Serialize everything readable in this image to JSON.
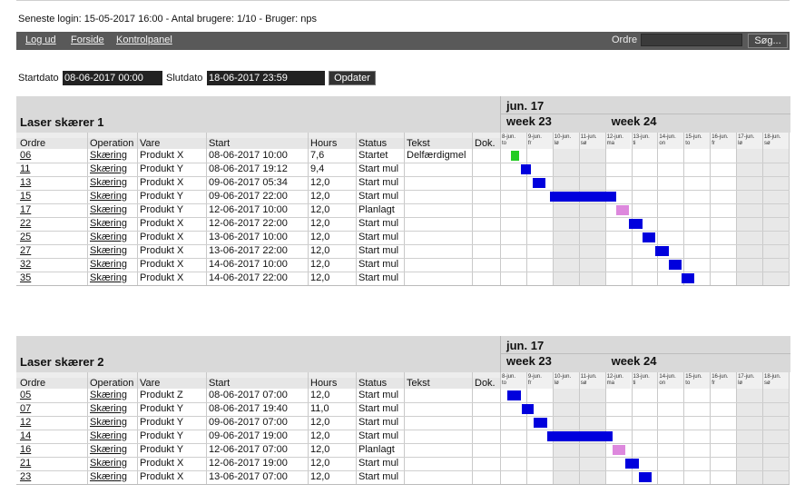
{
  "header": {
    "login_info": "Seneste login: 15-05-2017 16:00 - Antal brugere: 1/10 - Bruger: nps"
  },
  "nav": {
    "logout": "Log ud",
    "home": "Forside",
    "control_panel": "Kontrolpanel",
    "order_label": "Ordre",
    "order_value": "",
    "search_button": "Søg..."
  },
  "filter": {
    "start_label": "Startdato",
    "start_value": "08-06-2017 00:00",
    "end_label": "Slutdato",
    "end_value": "18-06-2017 23:59",
    "update_button": "Opdater"
  },
  "columns": [
    "Ordre",
    "Operation",
    "Vare",
    "Start",
    "Hours",
    "Status",
    "Tekst",
    "Dok."
  ],
  "gantt": {
    "month": "jun. 17",
    "weeks": [
      "week 23",
      "week 24"
    ],
    "days": [
      {
        "date": "8-jun.",
        "dow": "to"
      },
      {
        "date": "9-jun.",
        "dow": "fr"
      },
      {
        "date": "10-jun.",
        "dow": "lø"
      },
      {
        "date": "11-jun.",
        "dow": "sø"
      },
      {
        "date": "12-jun.",
        "dow": "ma"
      },
      {
        "date": "13-jun.",
        "dow": "ti"
      },
      {
        "date": "14-jun.",
        "dow": "on"
      },
      {
        "date": "15-jun.",
        "dow": "to"
      },
      {
        "date": "16-jun.",
        "dow": "fr"
      },
      {
        "date": "17-jun.",
        "dow": "lø"
      },
      {
        "date": "18-jun.",
        "dow": "sø"
      }
    ],
    "weekend_days": [
      2,
      3,
      9,
      10
    ]
  },
  "colors": {
    "started": "#22cc22",
    "start_mul": "#0000dd",
    "planned": "#dd88dd"
  },
  "panels": [
    {
      "title": "Laser skærer 1",
      "rows": [
        {
          "order": "06",
          "operation": "Skæring",
          "item": "Produkt X",
          "start": "08-06-2017 10:00",
          "hours": "7,6",
          "status": "Startet",
          "text": "Delfærdigmel",
          "bar_start_day": 0.42,
          "bar_length_days": 0.32,
          "kind": "started"
        },
        {
          "order": "11",
          "operation": "Skæring",
          "item": "Produkt Y",
          "start": "08-06-2017 19:12",
          "hours": "9,4",
          "status": "Start mul",
          "text": "",
          "bar_start_day": 0.8,
          "bar_length_days": 0.39,
          "kind": "start_mul"
        },
        {
          "order": "13",
          "operation": "Skæring",
          "item": "Produkt X",
          "start": "09-06-2017 05:34",
          "hours": "12,0",
          "status": "Start mul",
          "text": "",
          "bar_start_day": 1.23,
          "bar_length_days": 0.5,
          "kind": "start_mul"
        },
        {
          "order": "15",
          "operation": "Skæring",
          "item": "Produkt Y",
          "start": "09-06-2017 22:00",
          "hours": "12,0",
          "status": "Start mul",
          "text": "",
          "bar_start_day": 1.92,
          "bar_length_days": 2.5,
          "kind": "start_mul"
        },
        {
          "order": "17",
          "operation": "Skæring",
          "item": "Produkt Y",
          "start": "12-06-2017 10:00",
          "hours": "12,0",
          "status": "Planlagt",
          "text": "",
          "bar_start_day": 4.42,
          "bar_length_days": 0.5,
          "kind": "planned"
        },
        {
          "order": "22",
          "operation": "Skæring",
          "item": "Produkt X",
          "start": "12-06-2017 22:00",
          "hours": "12,0",
          "status": "Start mul",
          "text": "",
          "bar_start_day": 4.92,
          "bar_length_days": 0.5,
          "kind": "start_mul"
        },
        {
          "order": "25",
          "operation": "Skæring",
          "item": "Produkt X",
          "start": "13-06-2017 10:00",
          "hours": "12,0",
          "status": "Start mul",
          "text": "",
          "bar_start_day": 5.42,
          "bar_length_days": 0.5,
          "kind": "start_mul"
        },
        {
          "order": "27",
          "operation": "Skæring",
          "item": "Produkt X",
          "start": "13-06-2017 22:00",
          "hours": "12,0",
          "status": "Start mul",
          "text": "",
          "bar_start_day": 5.92,
          "bar_length_days": 0.5,
          "kind": "start_mul"
        },
        {
          "order": "32",
          "operation": "Skæring",
          "item": "Produkt X",
          "start": "14-06-2017 10:00",
          "hours": "12,0",
          "status": "Start mul",
          "text": "",
          "bar_start_day": 6.42,
          "bar_length_days": 0.5,
          "kind": "start_mul"
        },
        {
          "order": "35",
          "operation": "Skæring",
          "item": "Produkt X",
          "start": "14-06-2017 22:00",
          "hours": "12,0",
          "status": "Start mul",
          "text": "",
          "bar_start_day": 6.92,
          "bar_length_days": 0.5,
          "kind": "start_mul"
        }
      ]
    },
    {
      "title": "Laser skærer 2",
      "rows": [
        {
          "order": "05",
          "operation": "Skæring",
          "item": "Produkt Z",
          "start": "08-06-2017 07:00",
          "hours": "12,0",
          "status": "Start mul",
          "text": "",
          "bar_start_day": 0.29,
          "bar_length_days": 0.5,
          "kind": "start_mul"
        },
        {
          "order": "07",
          "operation": "Skæring",
          "item": "Produkt Y",
          "start": "08-06-2017 19:40",
          "hours": "11,0",
          "status": "Start mul",
          "text": "",
          "bar_start_day": 0.82,
          "bar_length_days": 0.46,
          "kind": "start_mul"
        },
        {
          "order": "12",
          "operation": "Skæring",
          "item": "Produkt Y",
          "start": "09-06-2017 07:00",
          "hours": "12,0",
          "status": "Start mul",
          "text": "",
          "bar_start_day": 1.29,
          "bar_length_days": 0.5,
          "kind": "start_mul"
        },
        {
          "order": "14",
          "operation": "Skæring",
          "item": "Produkt Y",
          "start": "09-06-2017 19:00",
          "hours": "12,0",
          "status": "Start mul",
          "text": "",
          "bar_start_day": 1.79,
          "bar_length_days": 2.5,
          "kind": "start_mul"
        },
        {
          "order": "16",
          "operation": "Skæring",
          "item": "Produkt Y",
          "start": "12-06-2017 07:00",
          "hours": "12,0",
          "status": "Planlagt",
          "text": "",
          "bar_start_day": 4.29,
          "bar_length_days": 0.5,
          "kind": "planned"
        },
        {
          "order": "21",
          "operation": "Skæring",
          "item": "Produkt X",
          "start": "12-06-2017 19:00",
          "hours": "12,0",
          "status": "Start mul",
          "text": "",
          "bar_start_day": 4.79,
          "bar_length_days": 0.5,
          "kind": "start_mul"
        },
        {
          "order": "23",
          "operation": "Skæring",
          "item": "Produkt X",
          "start": "13-06-2017 07:00",
          "hours": "12,0",
          "status": "Start mul",
          "text": "",
          "bar_start_day": 5.29,
          "bar_length_days": 0.5,
          "kind": "start_mul"
        }
      ]
    }
  ]
}
